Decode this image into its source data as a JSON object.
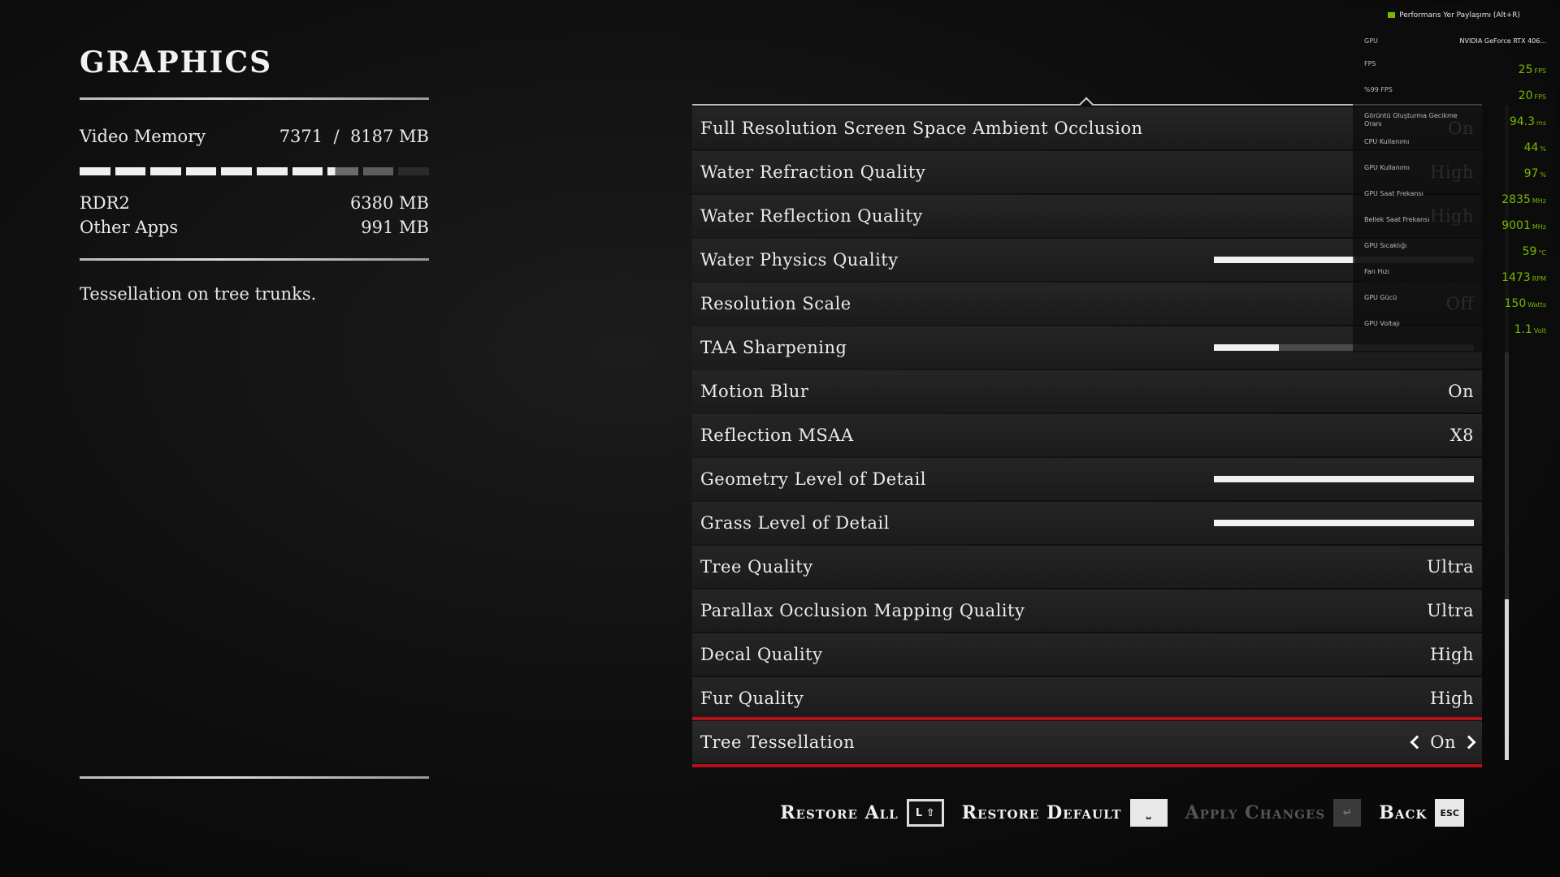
{
  "page": {
    "title": "GRAPHICS",
    "description": "Tessellation on tree trunks."
  },
  "memory": {
    "label": "Video Memory",
    "used": "7371",
    "sep": "/",
    "total": "8187 MB",
    "rdr2_label": "RDR2",
    "rdr2_value": "6380 MB",
    "other_label": "Other Apps",
    "other_value": "991 MB",
    "bar_rdr2_fraction": 0.779,
    "bar_other_fraction": 0.121
  },
  "settings": [
    {
      "label": "Full Resolution Screen Space Ambient Occlusion",
      "value": "On",
      "dim": true
    },
    {
      "label": "Water Refraction Quality",
      "value": "High",
      "dim": true
    },
    {
      "label": "Water Reflection Quality",
      "value": "High",
      "dim": true
    },
    {
      "label": "Water Physics Quality",
      "slider": 0.54
    },
    {
      "label": "Resolution Scale",
      "value": "Off",
      "dim": true
    },
    {
      "label": "TAA Sharpening",
      "slider": 0.25
    },
    {
      "label": "Motion Blur",
      "value": "On"
    },
    {
      "label": "Reflection MSAA",
      "value": "X8"
    },
    {
      "label": "Geometry Level of Detail",
      "slider": 1.0
    },
    {
      "label": "Grass Level of Detail",
      "slider": 1.0
    },
    {
      "label": "Tree Quality",
      "value": "Ultra"
    },
    {
      "label": "Parallax Occlusion Mapping Quality",
      "value": "Ultra"
    },
    {
      "label": "Decal Quality",
      "value": "High"
    },
    {
      "label": "Fur Quality",
      "value": "High"
    },
    {
      "label": "Tree Tessellation",
      "value": "On",
      "selected": true
    }
  ],
  "bottom": {
    "restore_all": "Restore All",
    "restore_all_key": "L ⇧",
    "restore_default": "Restore Default",
    "restore_default_key": "⎵",
    "apply_changes": "Apply Changes",
    "apply_changes_key": "↵",
    "back": "Back",
    "back_key": "ESC"
  },
  "overlay": {
    "title": "Performans Yer Paylaşımı (Alt+R)",
    "gpu_label": "GPU",
    "gpu_value": "NVIDIA GeForce RTX 406...",
    "metrics": [
      {
        "label": "FPS",
        "value": "25",
        "unit": "FPS"
      },
      {
        "label": "%99 FPS",
        "value": "20",
        "unit": "FPS"
      },
      {
        "label": "Görüntü Oluşturma Gecikme Oranı",
        "value": "94.3",
        "unit": "ms"
      },
      {
        "label": "CPU Kullanımı",
        "value": "44",
        "unit": "%"
      },
      {
        "label": "GPU Kullanımı",
        "value": "97",
        "unit": "%"
      },
      {
        "label": "GPU Saat Frekansı",
        "value": "2835",
        "unit": "MHz"
      },
      {
        "label": "Bellek Saat Frekansı",
        "value": "9001",
        "unit": "MHz"
      },
      {
        "label": "GPU Sıcaklığı",
        "value": "59",
        "unit": "°C"
      },
      {
        "label": "Fan Hızı",
        "value": "1473",
        "unit": "RPM"
      },
      {
        "label": "GPU Gücü",
        "value": "150",
        "unit": "Watts"
      },
      {
        "label": "GPU Voltajı",
        "value": "1.1",
        "unit": "Volt"
      }
    ],
    "accent": "#76b900"
  },
  "colors": {
    "selection_border": "#b3121c"
  }
}
